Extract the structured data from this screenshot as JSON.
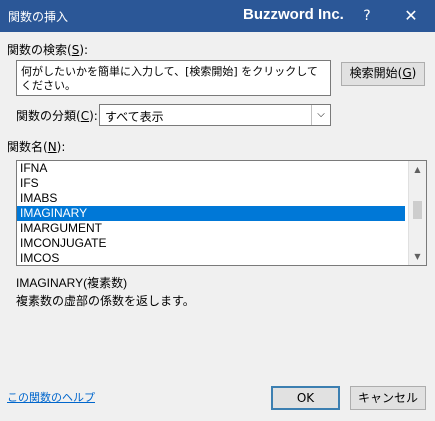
{
  "window": {
    "title": "関数の挿入",
    "brand": "Buzzword Inc.",
    "help_glyph": "?",
    "close_glyph": "✕"
  },
  "search": {
    "label_text": "関数の検索(",
    "label_key": "S",
    "label_end": "):",
    "value": "何がしたいかを簡単に入力して、[検索開始] をクリックしてください。",
    "button_text": "検索開始(",
    "button_key": "G",
    "button_end": ")"
  },
  "category": {
    "label_text": "関数の分類(",
    "label_key": "C",
    "label_end": "):",
    "selected": "すべて表示"
  },
  "function_list": {
    "label_text": "関数名(",
    "label_key": "N",
    "label_end": "):",
    "items": [
      "IFNA",
      "IFS",
      "IMABS",
      "IMAGINARY",
      "IMARGUMENT",
      "IMCONJUGATE",
      "IMCOS"
    ],
    "selected_index": 3
  },
  "description": {
    "signature": "IMAGINARY(複素数)",
    "text": "複素数の虚部の係数を返します。"
  },
  "footer": {
    "help_link": "この関数のヘルプ",
    "ok": "OK",
    "cancel": "キャンセル"
  }
}
